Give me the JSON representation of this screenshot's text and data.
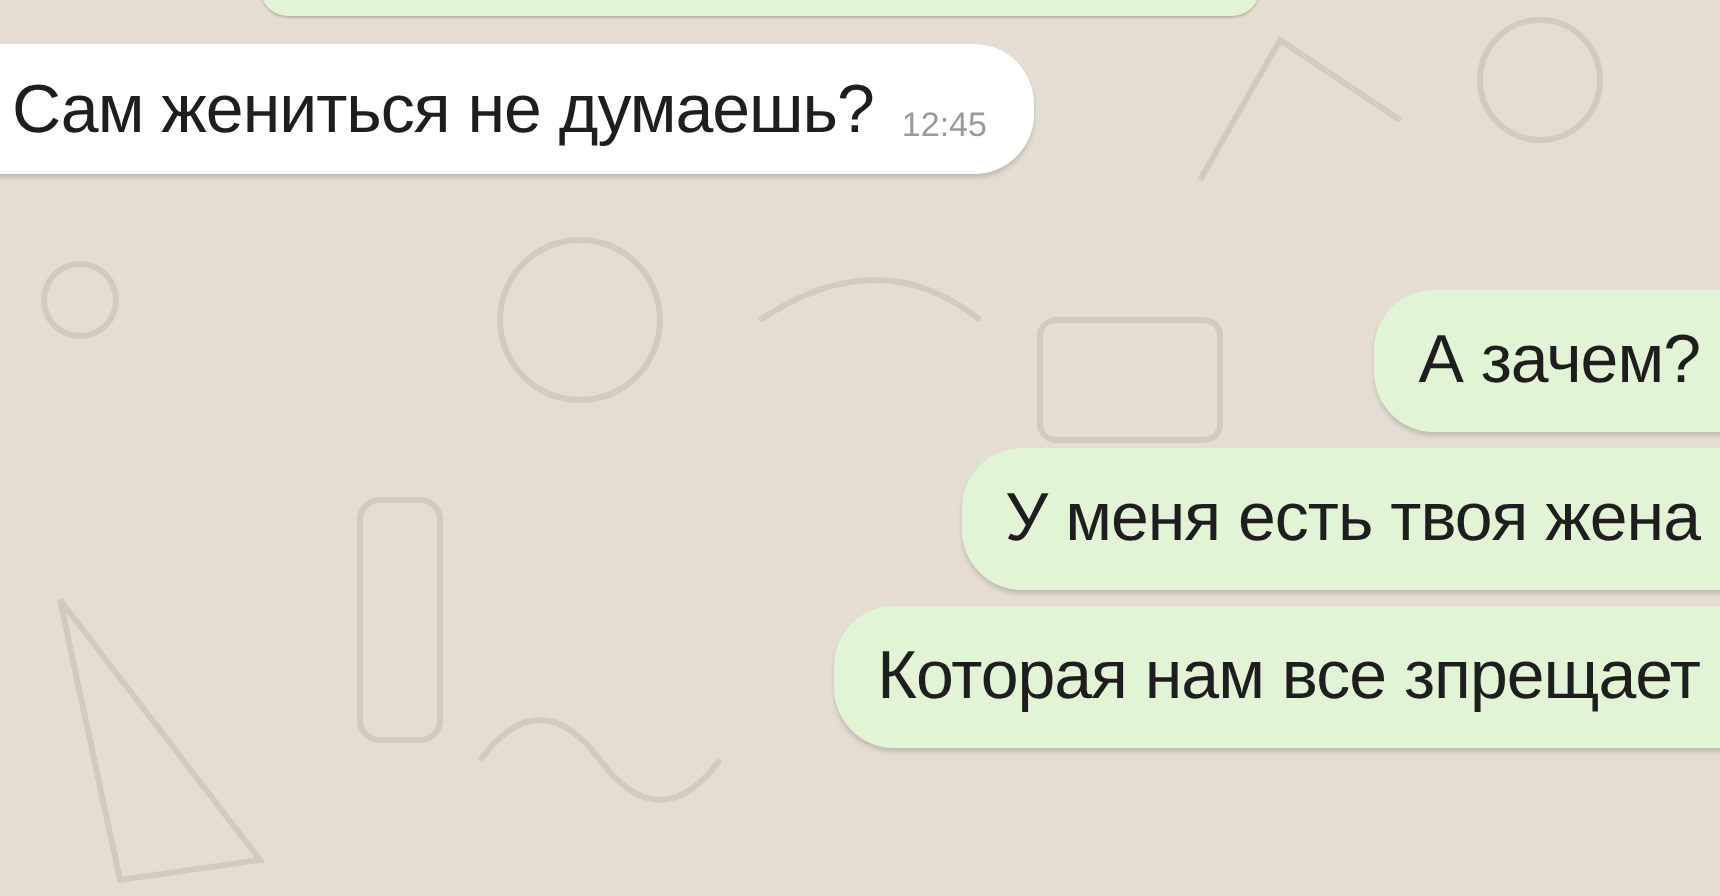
{
  "messages": [
    {
      "kind": "incoming",
      "text": "Сам жениться не думаешь?",
      "time": "12:45"
    },
    {
      "kind": "outgoing",
      "text": "А зачем?"
    },
    {
      "kind": "outgoing",
      "text": "У меня есть твоя жена"
    },
    {
      "kind": "outgoing",
      "text": "Которая нам все зпрещает"
    }
  ]
}
